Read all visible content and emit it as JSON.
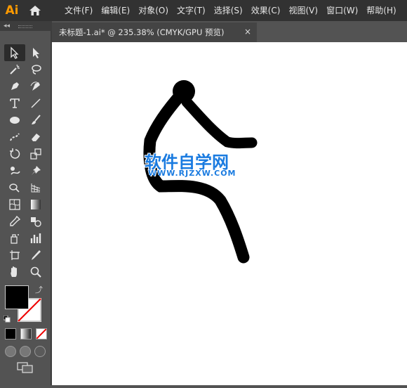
{
  "app": {
    "logo_text": "Ai"
  },
  "menu": [
    {
      "label": "文件(F)"
    },
    {
      "label": "编辑(E)"
    },
    {
      "label": "对象(O)"
    },
    {
      "label": "文字(T)"
    },
    {
      "label": "选择(S)"
    },
    {
      "label": "效果(C)"
    },
    {
      "label": "视图(V)"
    },
    {
      "label": "窗口(W)"
    },
    {
      "label": "帮助(H)"
    }
  ],
  "tools_panel": {
    "collapse_label": "◂◂"
  },
  "document": {
    "tab_title": "未标题-1.ai* @ 235.38% (CMYK/GPU 预览)",
    "close_label": "×"
  },
  "colors": {
    "fill": "#000000",
    "stroke": "none",
    "accent": "#ff9a00"
  },
  "watermark": {
    "main": "软件自学网",
    "sub": "WWW.RJZXW.COM"
  }
}
